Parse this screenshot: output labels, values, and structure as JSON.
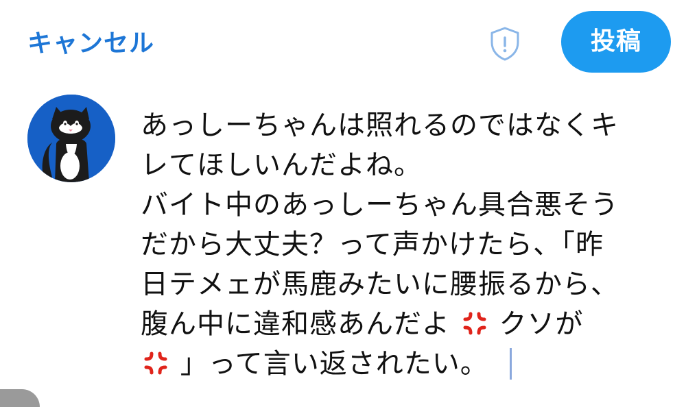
{
  "header": {
    "cancel_label": "キャンセル",
    "post_label": "投稿",
    "shield_icon": "shield-exclamation-icon",
    "accent_color": "#1d9bf0",
    "cancel_color": "#1d76d6"
  },
  "avatar": {
    "icon": "black-white-cat-avatar",
    "background_color": "#1660c6"
  },
  "compose": {
    "lines": [
      "あっしーちゃんは照れるのではなくキ",
      "レてほしいんだよね。",
      "バイト中のあっしーちゃん具合悪そう",
      "だから大丈夫？って声かけたら、「昨",
      "日テメェが馬鹿みたいに腰振るから、",
      "腹ん中に違和感あんだよ",
      "クソが",
      "」って言い返されたい。"
    ],
    "emoji": "anger-symbol-icon"
  }
}
